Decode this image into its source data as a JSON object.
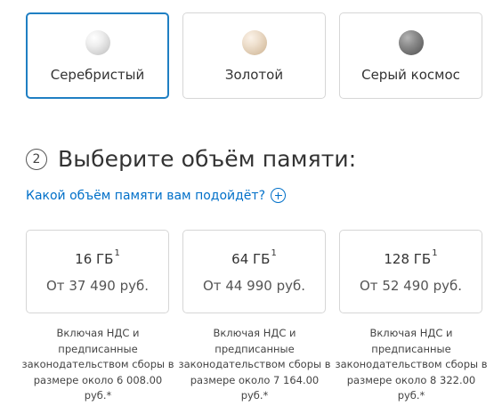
{
  "colors": [
    {
      "label": "Серебристый",
      "selected": true,
      "swatch": "silver"
    },
    {
      "label": "Золотой",
      "selected": false,
      "swatch": "gold"
    },
    {
      "label": "Серый космос",
      "selected": false,
      "swatch": "space-grey"
    }
  ],
  "step": {
    "number": "2",
    "title": "Выберите объём памяти:"
  },
  "help_link": {
    "label": "Какой объём памяти вам подойдёт?",
    "icon": "plus-circle-icon"
  },
  "storage": [
    {
      "capacity": "16 ГБ",
      "footnote": "1",
      "price": "От 37 490 руб."
    },
    {
      "capacity": "64 ГБ",
      "footnote": "1",
      "price": "От 44 990 руб."
    },
    {
      "capacity": "128 ГБ",
      "footnote": "1",
      "price": "От 52 490 руб."
    }
  ],
  "notes": [
    {
      "line1": "Включая НДС и",
      "line2": "предписанные",
      "line3": "законодательством сборы в",
      "line4": "размере около 6 008.00 руб.*"
    },
    {
      "line1": "Включая НДС и",
      "line2": "предписанные",
      "line3": "законодательством сборы в",
      "line4": "размере около 7 164.00 руб.*"
    },
    {
      "line1": "Включая НДС и",
      "line2": "предписанные",
      "line3": "законодательством сборы в",
      "line4": "размере около 8 322.00 руб.*"
    }
  ],
  "theme": {
    "accent": "#0070c9",
    "selected_border": "#1f7fc3",
    "card_border": "#d6d6d6"
  }
}
